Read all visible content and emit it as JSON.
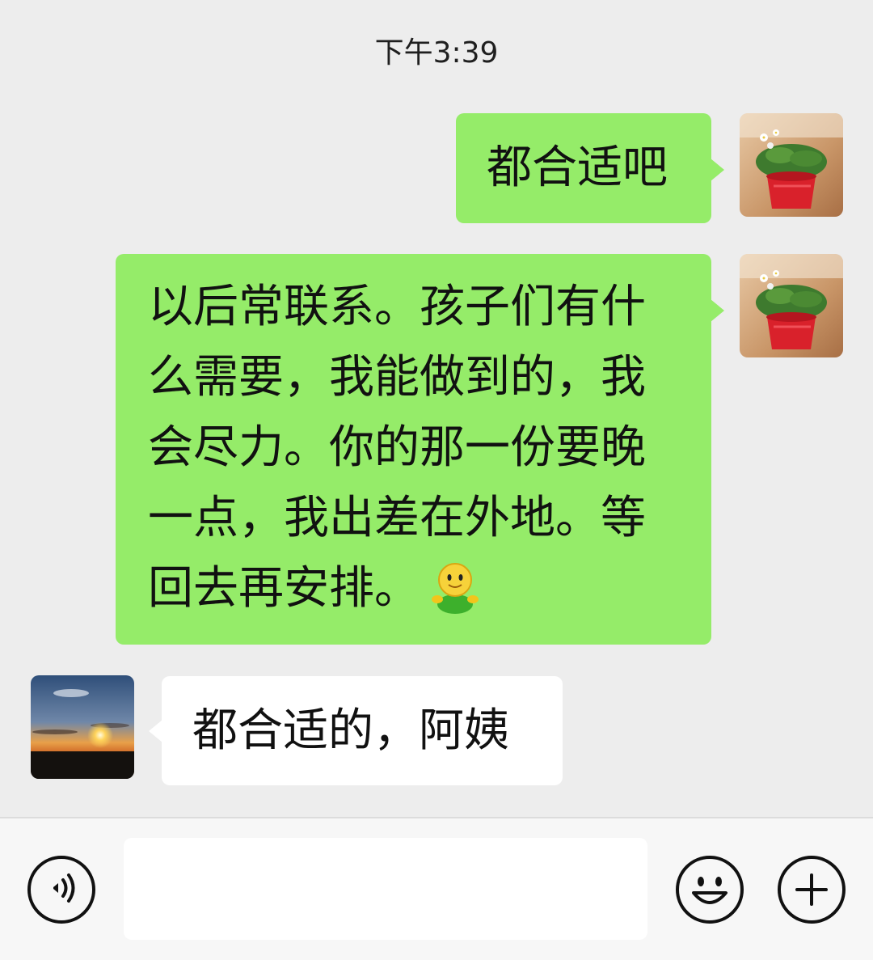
{
  "chat": {
    "timestamp": "下午3:39",
    "messages": [
      {
        "direction": "outgoing",
        "avatar_icon": "potted-plant-avatar",
        "text": "都合适吧"
      },
      {
        "direction": "outgoing",
        "avatar_icon": "potted-plant-avatar",
        "lines": [
          "以后常联系。孩子们有什",
          "么需要，我能做到的，我",
          "会尽力。你的那一份要晚",
          "一点，我出差在外地。等",
          "回去再安排。"
        ],
        "trailing_emoji": "smiling-figure-emoji"
      },
      {
        "direction": "incoming",
        "avatar_icon": "sunset-avatar",
        "text": "都合适的，阿姨"
      }
    ]
  },
  "input_bar": {
    "message_value": "",
    "icons": {
      "voice": "voice-icon",
      "emoji": "emoji-icon",
      "more": "plus-icon"
    }
  },
  "colors": {
    "outgoing_bubble": "#95ec69",
    "incoming_bubble": "#ffffff",
    "chat_background": "#ededed",
    "input_bar_background": "#f7f7f7"
  }
}
